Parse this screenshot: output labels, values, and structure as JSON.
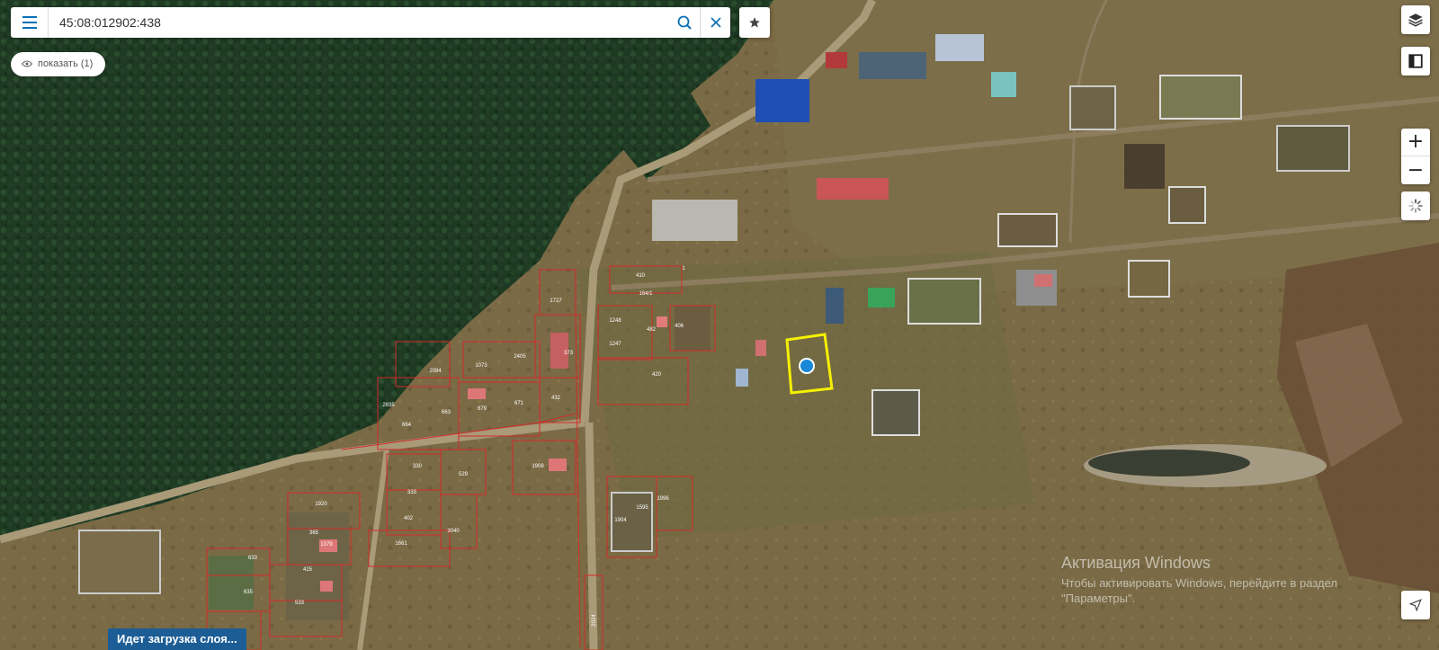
{
  "search": {
    "query": "45:08:012902:438"
  },
  "show_pill": {
    "label": "показать (1)"
  },
  "loading": {
    "label": "Идет загрузка слоя..."
  },
  "watermark": {
    "line1": "Активация Windows",
    "line2": "Чтобы активировать Windows, перейдите в раздел",
    "line3": "\"Параметры\"."
  },
  "controls": {
    "zoom_in": "+",
    "zoom_out": "−"
  },
  "icons": {
    "menu": "menu-icon",
    "search": "search-icon",
    "clear": "close-icon",
    "favorite": "star-icon",
    "eye": "eye-icon",
    "layers": "layers-icon",
    "ruler": "ruler-icon",
    "spinner": "spinner-icon",
    "locate": "locate-arrow-icon"
  },
  "colors": {
    "accent": "#0a6fb5",
    "selected_parcel": "#f5f000",
    "parcel_border": "#d42a2a",
    "loading_bg": "#1c5d96"
  },
  "parcels": [
    {
      "label": "410"
    },
    {
      "label": "1"
    },
    {
      "label": "1727"
    },
    {
      "label": "164/1"
    },
    {
      "label": "1248"
    },
    {
      "label": "482"
    },
    {
      "label": "406"
    },
    {
      "label": "1247"
    },
    {
      "label": "1073"
    },
    {
      "label": "2405"
    },
    {
      "label": "2084"
    },
    {
      "label": "373"
    },
    {
      "label": "420"
    },
    {
      "label": "432"
    },
    {
      "label": "671"
    },
    {
      "label": "679"
    },
    {
      "label": "2835"
    },
    {
      "label": "663"
    },
    {
      "label": "664"
    },
    {
      "label": "1908"
    },
    {
      "label": "330"
    },
    {
      "label": "529"
    },
    {
      "label": "333"
    },
    {
      "label": "402"
    },
    {
      "label": "3040"
    },
    {
      "label": "1661"
    },
    {
      "label": "1920"
    },
    {
      "label": "365"
    },
    {
      "label": "1379"
    },
    {
      "label": "415"
    },
    {
      "label": "633"
    },
    {
      "label": "635"
    },
    {
      "label": "533"
    },
    {
      "label": "1595"
    },
    {
      "label": "1996"
    },
    {
      "label": "1904"
    },
    {
      "label": "2024"
    }
  ]
}
